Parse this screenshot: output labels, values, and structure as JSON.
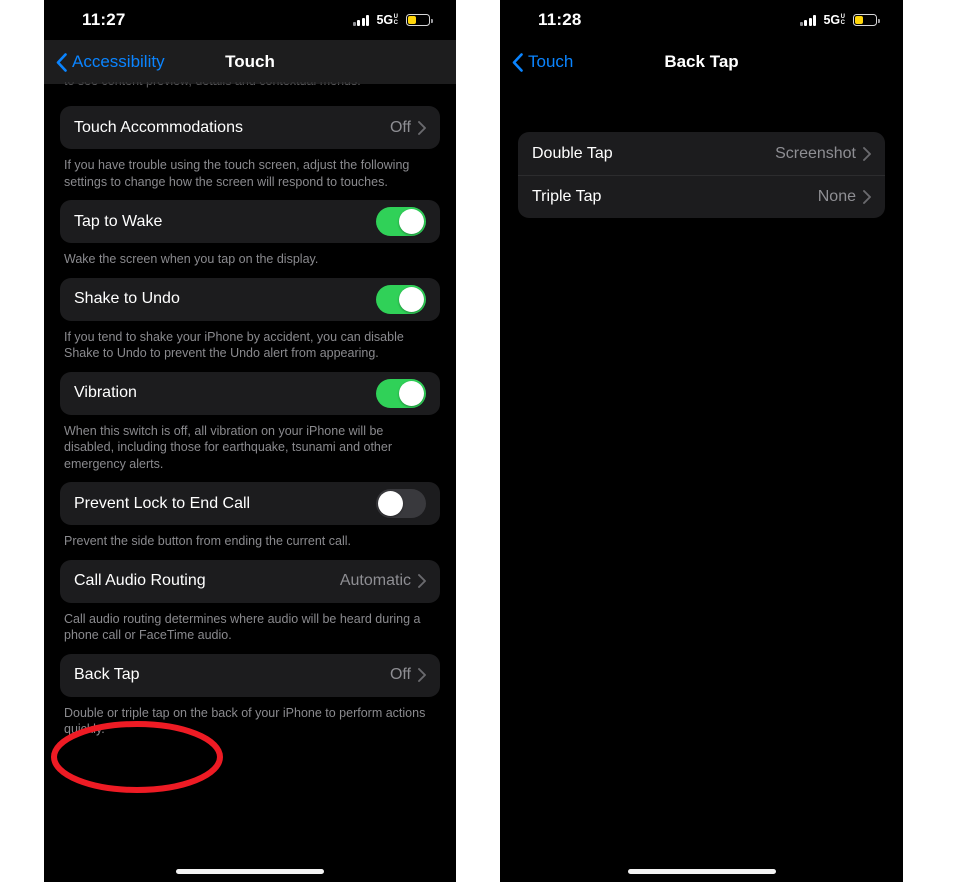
{
  "colors": {
    "accent_blue": "#0a84ff",
    "toggle_on_green": "#30d158",
    "toggle_off_gray": "#39393d",
    "card_bg": "#1c1c1e",
    "screen_bg": "#000000",
    "secondary_text": "#8e8e93",
    "annotation_red": "#ee1b24",
    "battery_yellow": "#ffd60a"
  },
  "left_phone": {
    "status_bar": {
      "clock": "11:27",
      "network_label": "5G",
      "network_superscript": "U",
      "network_subscript": "C",
      "signal_icon": "cellular-bars-icon",
      "battery_icon": "battery-low-icon"
    },
    "nav": {
      "back_label": "Accessibility",
      "back_icon": "chevron-left-icon",
      "title": "Touch"
    },
    "clipped_footnote": "to see content preview, details and contextual menus.",
    "sections": [
      {
        "rows": [
          {
            "label": "Touch Accommodations",
            "value": "Off",
            "type": "disclosure",
            "accessory_icon": "chevron-right-icon"
          }
        ],
        "footnote": "If you have trouble using the touch screen, adjust the following settings to change how the screen will respond to touches."
      },
      {
        "rows": [
          {
            "label": "Tap to Wake",
            "type": "toggle",
            "toggle_state": "on"
          }
        ],
        "footnote": "Wake the screen when you tap on the display."
      },
      {
        "rows": [
          {
            "label": "Shake to Undo",
            "type": "toggle",
            "toggle_state": "on"
          }
        ],
        "footnote": "If you tend to shake your iPhone by accident, you can disable Shake to Undo to prevent the Undo alert from appearing."
      },
      {
        "rows": [
          {
            "label": "Vibration",
            "type": "toggle",
            "toggle_state": "on"
          }
        ],
        "footnote": "When this switch is off, all vibration on your iPhone will be disabled, including those for earthquake, tsunami and other emergency alerts."
      },
      {
        "rows": [
          {
            "label": "Prevent Lock to End Call",
            "type": "toggle",
            "toggle_state": "off"
          }
        ],
        "footnote": "Prevent the side button from ending the current call."
      },
      {
        "rows": [
          {
            "label": "Call Audio Routing",
            "value": "Automatic",
            "type": "disclosure",
            "accessory_icon": "chevron-right-icon"
          }
        ],
        "footnote": "Call audio routing determines where audio will be heard during a phone call or FaceTime audio."
      },
      {
        "rows": [
          {
            "label": "Back Tap",
            "value": "Off",
            "type": "disclosure",
            "accessory_icon": "chevron-right-icon"
          }
        ],
        "footnote": "Double or triple tap on the back of your iPhone to perform actions quickly."
      }
    ],
    "annotation": {
      "shape": "ellipse",
      "target": "Back Tap",
      "color": "#ee1b24"
    }
  },
  "right_phone": {
    "status_bar": {
      "clock": "11:28",
      "network_label": "5G",
      "network_superscript": "U",
      "network_subscript": "C",
      "signal_icon": "cellular-bars-icon",
      "battery_icon": "battery-low-icon"
    },
    "nav": {
      "back_label": "Touch",
      "back_icon": "chevron-left-icon",
      "title": "Back Tap"
    },
    "sections": [
      {
        "rows": [
          {
            "label": "Double Tap",
            "value": "Screenshot",
            "type": "disclosure",
            "accessory_icon": "chevron-right-icon"
          },
          {
            "label": "Triple Tap",
            "value": "None",
            "type": "disclosure",
            "accessory_icon": "chevron-right-icon"
          }
        ]
      }
    ]
  }
}
